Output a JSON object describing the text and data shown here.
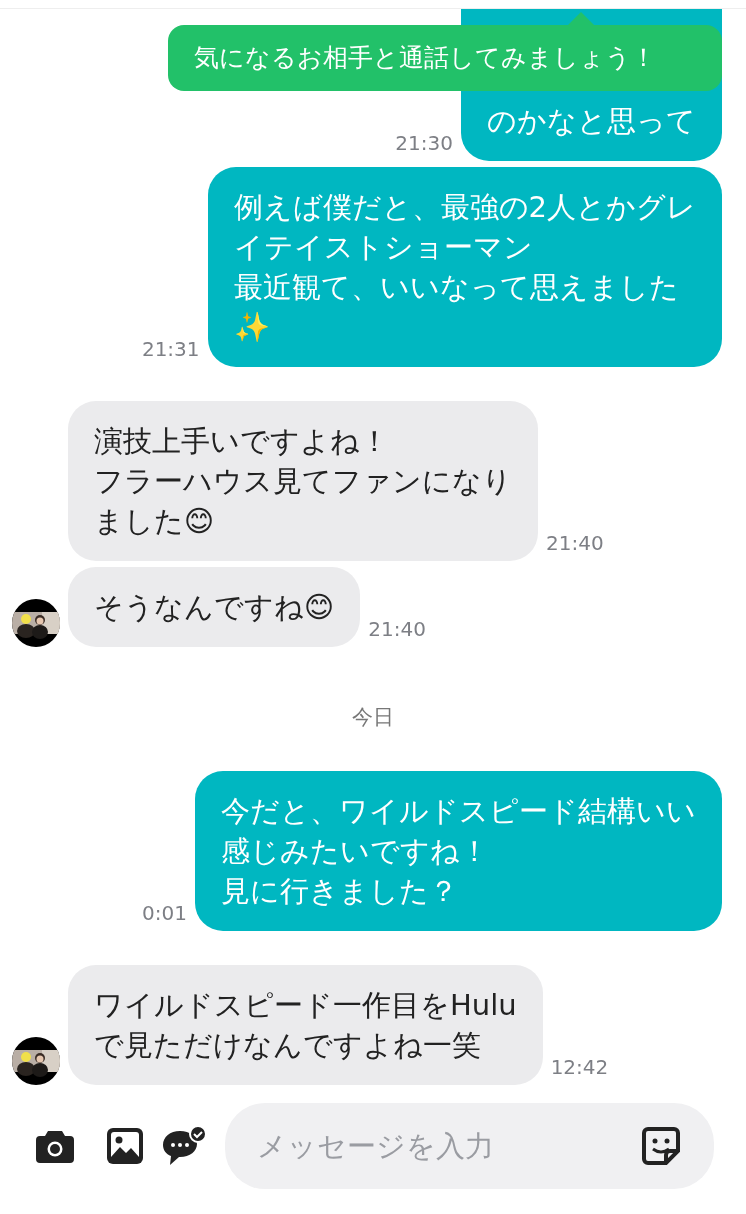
{
  "tooltip": {
    "text": "気になるお相手と通話してみましょう！"
  },
  "messages": [
    {
      "kind": "sent",
      "lines": [
        "のかなと思って"
      ],
      "time": "21:30",
      "clipped": true
    },
    {
      "kind": "sent",
      "lines": [
        "例えば僕だと、最強の2人とかグレ",
        "イテイストショーマン",
        "最近観て、いいなって思えました",
        "✨"
      ],
      "time": "21:31",
      "clipped": false
    },
    {
      "kind": "received",
      "lines": [
        "演技上手いですよね！",
        "フラーハウス見てファンになり",
        "ました😊"
      ],
      "time": "21:40",
      "avatar": false
    },
    {
      "kind": "received",
      "lines": [
        "そうなんですね😊"
      ],
      "time": "21:40",
      "avatar": true
    },
    {
      "kind": "date",
      "text": "今日"
    },
    {
      "kind": "sent",
      "lines": [
        "今だと、ワイルドスピード結構いい",
        "感じみたいですね！",
        "見に行きました？"
      ],
      "time": "0:01",
      "clipped": false
    },
    {
      "kind": "received",
      "lines": [
        "ワイルドスピード一作目をHulu",
        "で見ただけなんですよね一笑"
      ],
      "time": "12:42",
      "avatar": true
    }
  ],
  "composer": {
    "placeholder": "メッセージを入力"
  }
}
